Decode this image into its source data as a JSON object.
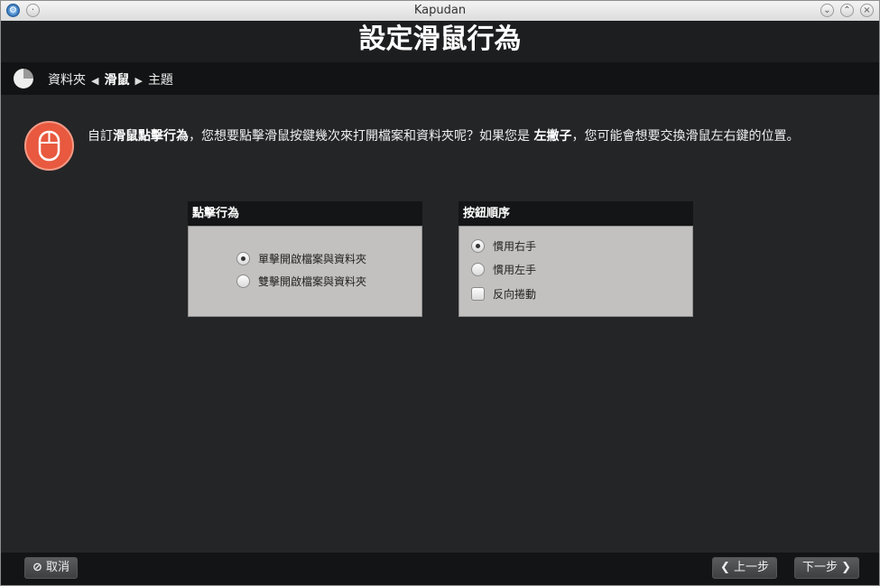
{
  "window": {
    "title": "Kapudan"
  },
  "header": {
    "title": "設定滑鼠行為"
  },
  "breadcrumb": {
    "items": [
      "資料夾",
      "滑鼠",
      "主題"
    ]
  },
  "intro": {
    "pre": "自訂",
    "bold1": "滑鼠點擊行為",
    "mid": "，您想要點擊滑鼠按鍵幾次來打開檔案和資料夾呢？如果您是",
    "bold2": "左撇子",
    "post": "，您可能會想要交換滑鼠左右鍵的位置。"
  },
  "click_panel": {
    "title": "點擊行為",
    "options": [
      {
        "label": "單擊開啟檔案與資料夾",
        "selected": true
      },
      {
        "label": "雙擊開啟檔案與資料夾",
        "selected": false
      }
    ]
  },
  "button_panel": {
    "title": "按鈕順序",
    "options": [
      {
        "label": "慣用右手",
        "selected": true
      },
      {
        "label": "慣用左手",
        "selected": false
      }
    ],
    "reverse_scroll": {
      "label": "反向捲動",
      "checked": false
    }
  },
  "footer": {
    "cancel": "取消",
    "back": "上一步",
    "next": "下一步"
  },
  "icons": {
    "app": "kde-app-icon",
    "intro": "mouse-icon",
    "progress": "pie-progress-icon"
  },
  "colors": {
    "accent": "#e8593f",
    "panel": "#c2c1bf",
    "background": "#242527"
  }
}
